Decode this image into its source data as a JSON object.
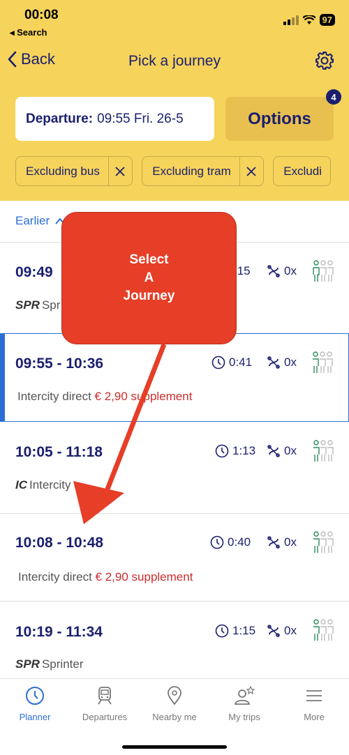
{
  "status": {
    "time": "00:08",
    "back_app": "◂ Search",
    "battery": "97"
  },
  "nav": {
    "back_label": "Back",
    "title": "Pick a journey"
  },
  "departure": {
    "label": "Departure:",
    "value": "09:55 Fri. 26-5"
  },
  "options": {
    "label": "Options",
    "badge": "4"
  },
  "filters": [
    "Excluding bus",
    "Excluding tram",
    "Excludi"
  ],
  "earlier_label": "Earlier",
  "journeys": [
    {
      "time": "09:49",
      "duration": ":15",
      "transfers": "0x",
      "type_code": "SPR",
      "type_name": "Spr"
    },
    {
      "time": "09:55 - 10:36",
      "duration": "0:41",
      "transfers": "0x",
      "type_name": "Intercity direct",
      "supplement": "€ 2,90 supplement"
    },
    {
      "time": "10:05 - 11:18",
      "duration": "1:13",
      "transfers": "0x",
      "type_code": "IC",
      "type_name": "Intercity"
    },
    {
      "time": "10:08 - 10:48",
      "duration": "0:40",
      "transfers": "0x",
      "type_name": "Intercity direct",
      "supplement": "€ 2,90 supplement"
    },
    {
      "time": "10:19 - 11:34",
      "duration": "1:15",
      "transfers": "0x",
      "type_code": "SPR",
      "type_name": "Sprinter"
    }
  ],
  "annotation": {
    "line1": "Select",
    "line2": "A",
    "line3": "Journey"
  },
  "tabs": [
    {
      "label": "Planner",
      "icon": "clock-icon",
      "active": true
    },
    {
      "label": "Departures",
      "icon": "train-icon"
    },
    {
      "label": "Nearby me",
      "icon": "location-pin-icon"
    },
    {
      "label": "My trips",
      "icon": "person-star-icon"
    },
    {
      "label": "More",
      "icon": "menu-icon"
    }
  ],
  "colors": {
    "brand_yellow": "#f6d35b",
    "navy": "#1a1f6e",
    "accent_blue": "#2b6fd6",
    "supplement_red": "#cc2d2d",
    "annotation_red": "#e63e27"
  }
}
